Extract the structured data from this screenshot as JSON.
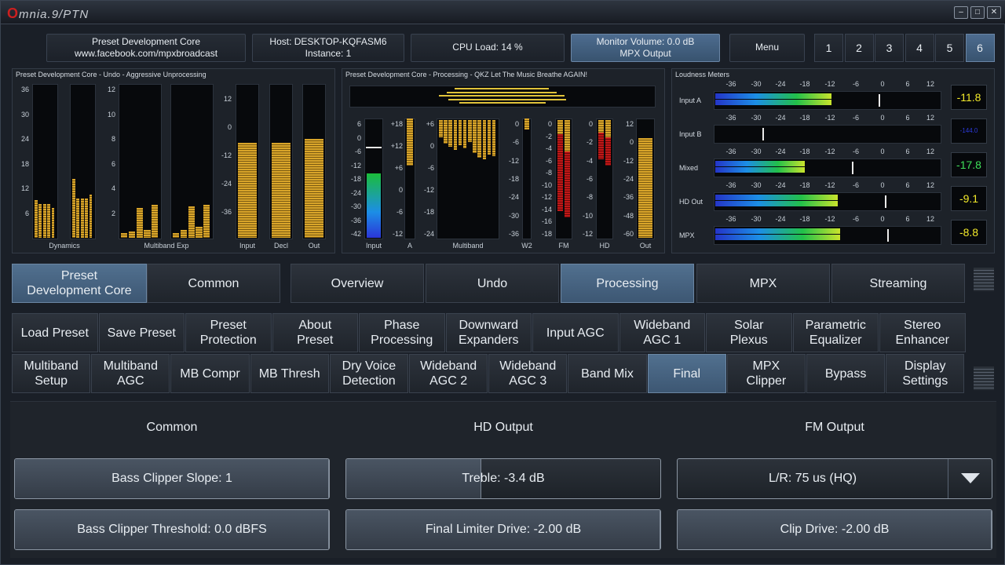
{
  "app": {
    "logo_text": "mnia.9/PTN",
    "logo_letter": "O"
  },
  "top": {
    "preset_line1": "Preset Development Core",
    "preset_line2": "www.facebook.com/mpxbroadcast",
    "host_line1": "Host: DESKTOP-KQFASM6",
    "host_line2": "Instance: 1",
    "cpu": "CPU Load: 14 %",
    "monitor_line1": "Monitor Volume: 0.0 dB",
    "monitor_line2": "MPX Output",
    "menu": "Menu",
    "nums": [
      "1",
      "2",
      "3",
      "4",
      "5",
      "6"
    ],
    "active_num": "6"
  },
  "panels": {
    "left_title": "Preset Development Core - Undo - Aggressive Unprocessing",
    "left_scale_a": [
      "36",
      "30",
      "24",
      "18",
      "12",
      "6"
    ],
    "left_scale_b": [
      "12",
      "10",
      "8",
      "6",
      "4",
      "2"
    ],
    "left_scale_c": [
      "12",
      "0",
      "-12",
      "-24",
      "-36"
    ],
    "left_labels": [
      "Dynamics",
      "Multiband Exp",
      "Input",
      "Decl",
      "Out"
    ],
    "mid_title": "Preset Development Core - Processing - QKZ Let The Music Breathe AGAIN!",
    "mid_scale_input": [
      "6",
      "0",
      "-6",
      "-12",
      "-18",
      "-24",
      "-30",
      "-36",
      "-42"
    ],
    "mid_scale_a": [
      "+18",
      "+12",
      "+6",
      "0",
      "-6",
      "-12"
    ],
    "mid_scale_mb": [
      "+6",
      "0",
      "-6",
      "-12",
      "-18",
      "-24"
    ],
    "mid_scale_w2": [
      "0",
      "-6",
      "-12",
      "-18",
      "-24",
      "-30",
      "-36"
    ],
    "mid_scale_fm": [
      "0",
      "-2",
      "-4",
      "-6",
      "-8",
      "-10",
      "-12",
      "-14",
      "-16",
      "-18"
    ],
    "mid_scale_hd": [
      "0",
      "-2",
      "-4",
      "-6",
      "-8",
      "-10",
      "-12"
    ],
    "mid_scale_out": [
      "12",
      "0",
      "-12",
      "-24",
      "-36",
      "-48",
      "-60"
    ],
    "mid_labels": [
      "Input",
      "A",
      "Multiband",
      "W2",
      "FM",
      "HD",
      "Out"
    ],
    "loud_title": "Loudness Meters",
    "loud_scale": [
      "-36",
      "-30",
      "-24",
      "-18",
      "-12",
      "-6",
      "0",
      "6",
      "12"
    ],
    "loud_rows": [
      {
        "label": "Input A",
        "value": "-11.8",
        "color": "#f2e92a",
        "level": 0.57
      },
      {
        "label": "Input B",
        "value": "-144.0",
        "color": "#2b3ad8",
        "level": 0.0
      },
      {
        "label": "Mixed",
        "value": "-17.8",
        "color": "#3fe05a",
        "level": 0.44
      },
      {
        "label": "HD Out",
        "value": "-9.1",
        "color": "#f2e92a",
        "level": 0.6
      },
      {
        "label": "MPX",
        "value": "-8.8",
        "color": "#f2e92a",
        "level": 0.61
      }
    ]
  },
  "tabs": [
    "Preset\nDevelopment Core",
    "Common",
    "Overview",
    "Undo",
    "Processing",
    "MPX",
    "Streaming"
  ],
  "subtabs_row1": [
    "Load Preset",
    "Save Preset",
    "Preset\nProtection",
    "About\nPreset",
    "Phase\nProcessing",
    "Downward\nExpanders",
    "Input AGC",
    "Wideband\nAGC 1",
    "Solar\nPlexus",
    "Parametric\nEqualizer",
    "Stereo\nEnhancer"
  ],
  "subtabs_row2": [
    "Multiband\nSetup",
    "Multiband\nAGC",
    "MB Compr",
    "MB Thresh",
    "Dry Voice\nDetection",
    "Wideband\nAGC 2",
    "Wideband\nAGC 3",
    "Band Mix",
    "Final",
    "MPX\nClipper",
    "Bypass",
    "Display\nSettings"
  ],
  "content": {
    "col_common": "Common",
    "col_hd": "HD Output",
    "col_fm": "FM Output",
    "bass_slope": "Bass Clipper Slope: 1",
    "bass_threshold": "Bass Clipper Threshold: 0.0 dBFS",
    "treble": "Treble: -3.4 dB",
    "final_limiter": "Final Limiter Drive: -2.00 dB",
    "lr": "L/R: 75 us (HQ)",
    "clip_drive": "Clip Drive: -2.00 dB",
    "treble_level": 0.43,
    "bass_threshold_level": 1.0,
    "bass_slope_level": 1.0,
    "final_limiter_level": 1.0,
    "clip_drive_level": 1.0
  },
  "colors": {
    "accent": "#4d6c8f",
    "meter_gold": "#d9a52a",
    "meter_red": "#c01818"
  }
}
